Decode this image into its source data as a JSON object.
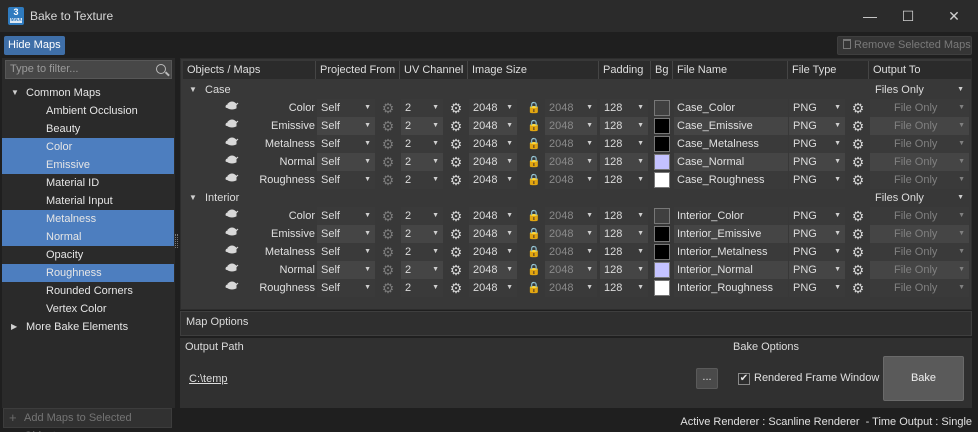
{
  "window": {
    "title": "Bake to Texture",
    "app_icon_text": "3",
    "app_icon_sub": "MAX",
    "minimize": "—",
    "maximize": "☐",
    "close": "✕"
  },
  "toolbar": {
    "hide_maps_label": "Hide Maps",
    "remove_selected_label": "Remove Selected Maps"
  },
  "filter": {
    "placeholder": "Type to filter..."
  },
  "tree": {
    "common_maps_label": "Common Maps",
    "items": [
      {
        "label": "Ambient Occlusion",
        "selected": false
      },
      {
        "label": "Beauty",
        "selected": false
      },
      {
        "label": "Color",
        "selected": true
      },
      {
        "label": "Emissive",
        "selected": true
      },
      {
        "label": "Material ID",
        "selected": false
      },
      {
        "label": "Material Input",
        "selected": false
      },
      {
        "label": "Metalness",
        "selected": true
      },
      {
        "label": "Normal",
        "selected": true
      },
      {
        "label": "Opacity",
        "selected": false
      },
      {
        "label": "Roughness",
        "selected": true
      },
      {
        "label": "Rounded Corners",
        "selected": false
      },
      {
        "label": "Vertex Color",
        "selected": false
      }
    ],
    "more_label": "More Bake Elements",
    "add_maps_label": "Add Maps to Selected Objects"
  },
  "table": {
    "headers": {
      "objects": "Objects / Maps",
      "projected": "Projected From",
      "uv": "UV Channel",
      "imgsize": "Image Size",
      "padding": "Padding",
      "bg": "Bg",
      "fname": "File Name",
      "ftype": "File Type",
      "output": "Output To"
    },
    "groups": [
      {
        "name": "Case",
        "output": "Files Only",
        "rows": [
          {
            "map": "Color",
            "projected": "Self",
            "uv": "2",
            "size": "2048",
            "size2": "2048",
            "padding": "128",
            "bg": "#404040",
            "fname": "Case_Color",
            "ftype": "PNG",
            "output": "File Only"
          },
          {
            "map": "Emissive",
            "projected": "Self",
            "uv": "2",
            "size": "2048",
            "size2": "2048",
            "padding": "128",
            "bg": "#000000",
            "fname": "Case_Emissive",
            "ftype": "PNG",
            "output": "File Only"
          },
          {
            "map": "Metalness",
            "projected": "Self",
            "uv": "2",
            "size": "2048",
            "size2": "2048",
            "padding": "128",
            "bg": "#000000",
            "fname": "Case_Metalness",
            "ftype": "PNG",
            "output": "File Only"
          },
          {
            "map": "Normal",
            "projected": "Self",
            "uv": "2",
            "size": "2048",
            "size2": "2048",
            "padding": "128",
            "bg": "#c4c2ff",
            "fname": "Case_Normal",
            "ftype": "PNG",
            "output": "File Only"
          },
          {
            "map": "Roughness",
            "projected": "Self",
            "uv": "2",
            "size": "2048",
            "size2": "2048",
            "padding": "128",
            "bg": "#ffffff",
            "fname": "Case_Roughness",
            "ftype": "PNG",
            "output": "File Only"
          }
        ]
      },
      {
        "name": "Interior",
        "output": "Files Only",
        "rows": [
          {
            "map": "Color",
            "projected": "Self",
            "uv": "2",
            "size": "2048",
            "size2": "2048",
            "padding": "128",
            "bg": "#404040",
            "fname": "Interior_Color",
            "ftype": "PNG",
            "output": "File Only"
          },
          {
            "map": "Emissive",
            "projected": "Self",
            "uv": "2",
            "size": "2048",
            "size2": "2048",
            "padding": "128",
            "bg": "#000000",
            "fname": "Interior_Emissive",
            "ftype": "PNG",
            "output": "File Only"
          },
          {
            "map": "Metalness",
            "projected": "Self",
            "uv": "2",
            "size": "2048",
            "size2": "2048",
            "padding": "128",
            "bg": "#000000",
            "fname": "Interior_Metalness",
            "ftype": "PNG",
            "output": "File Only"
          },
          {
            "map": "Normal",
            "projected": "Self",
            "uv": "2",
            "size": "2048",
            "size2": "2048",
            "padding": "128",
            "bg": "#c4c2ff",
            "fname": "Interior_Normal",
            "ftype": "PNG",
            "output": "File Only"
          },
          {
            "map": "Roughness",
            "projected": "Self",
            "uv": "2",
            "size": "2048",
            "size2": "2048",
            "padding": "128",
            "bg": "#ffffff",
            "fname": "Interior_Roughness",
            "ftype": "PNG",
            "output": "File Only"
          }
        ]
      }
    ]
  },
  "map_options": {
    "label": "Map Options"
  },
  "output_path": {
    "label": "Output Path",
    "value": "C:\\temp",
    "browse_label": "..."
  },
  "bake_options": {
    "label": "Bake Options",
    "rendered_frame_window_label": "Rendered Frame Window",
    "rendered_frame_window_checked": true,
    "bake_label": "Bake"
  },
  "status": {
    "text": "Active Renderer : Scanline Renderer  - Time Output : Single"
  },
  "colors": {
    "selection": "#4d7ebf",
    "hide_maps_button": "#3f6fa8",
    "background": "#1f1f1f"
  }
}
